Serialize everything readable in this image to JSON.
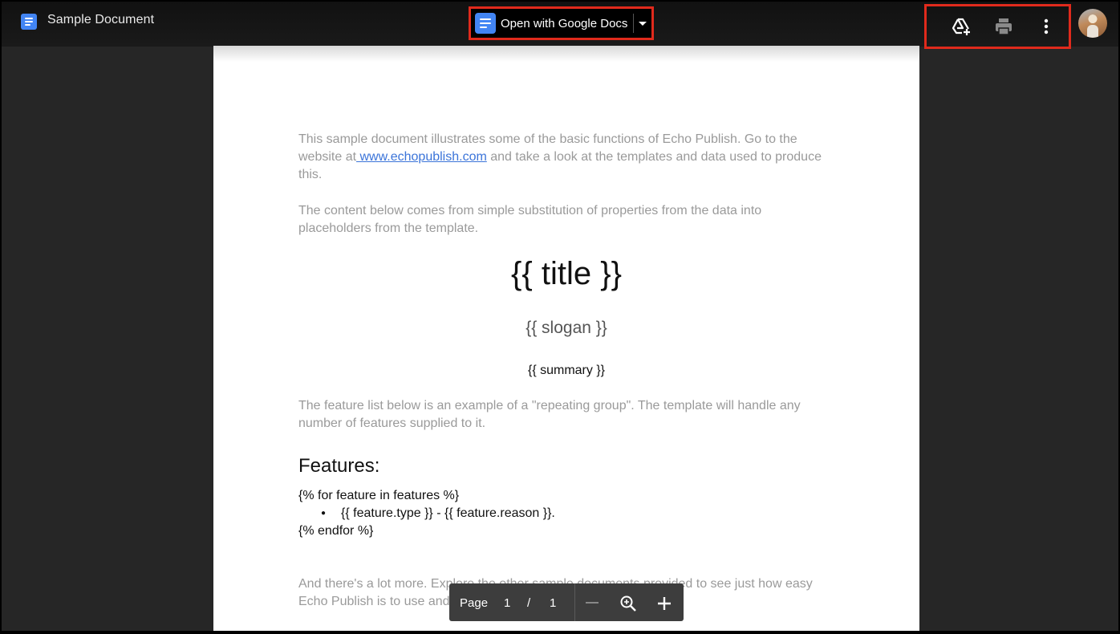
{
  "header": {
    "app_icon": "google-docs-icon",
    "title": "Sample Document",
    "open_with_label": "Open with Google Docs",
    "open_with_icon": "google-docs-icon",
    "open_with_dropdown_icon": "caret-down-icon",
    "actions": [
      {
        "name": "add-to-drive",
        "icon": "add-to-drive-icon"
      },
      {
        "name": "print",
        "icon": "print-icon"
      },
      {
        "name": "more-options",
        "icon": "more-vertical-icon"
      }
    ],
    "avatar": "user-avatar"
  },
  "highlight_color": "#e02a1c",
  "document": {
    "intro_p1_before_link": "This sample document illustrates some of the basic functions of Echo Publish. Go to the website at",
    "intro_link": " www.echopublish.com",
    "intro_p1_after_link": " and take a look at the templates and data used to produce this.",
    "intro_p2": "The content below comes from simple substitution of properties from the data into placeholders from the template.",
    "title_placeholder": "{{ title }}",
    "slogan_placeholder": "{{ slogan }}",
    "summary_placeholder": "{{ summary }}",
    "features_intro": "The feature list below is an example of a \"repeating group\". The template will handle any number of features supplied to it.",
    "features_heading": "Features:",
    "loop_start": "{% for feature in features %}",
    "bullet": "●",
    "feature_item": "{{ feature.type }} - {{ feature.reason }}.",
    "loop_end": "{% endfor %}",
    "closing_p_line1": "And there's a lot more.  Explore the other sample documents provided to see just how easy",
    "closing_p_line2": "Echo Publish is to use and how simple to build into your system."
  },
  "pager": {
    "label": "Page",
    "current": "1",
    "separator": "/",
    "total": "1",
    "zoom_out_icon": "minus-icon",
    "zoom_icon": "zoom-in-icon",
    "zoom_in_icon": "plus-icon"
  }
}
